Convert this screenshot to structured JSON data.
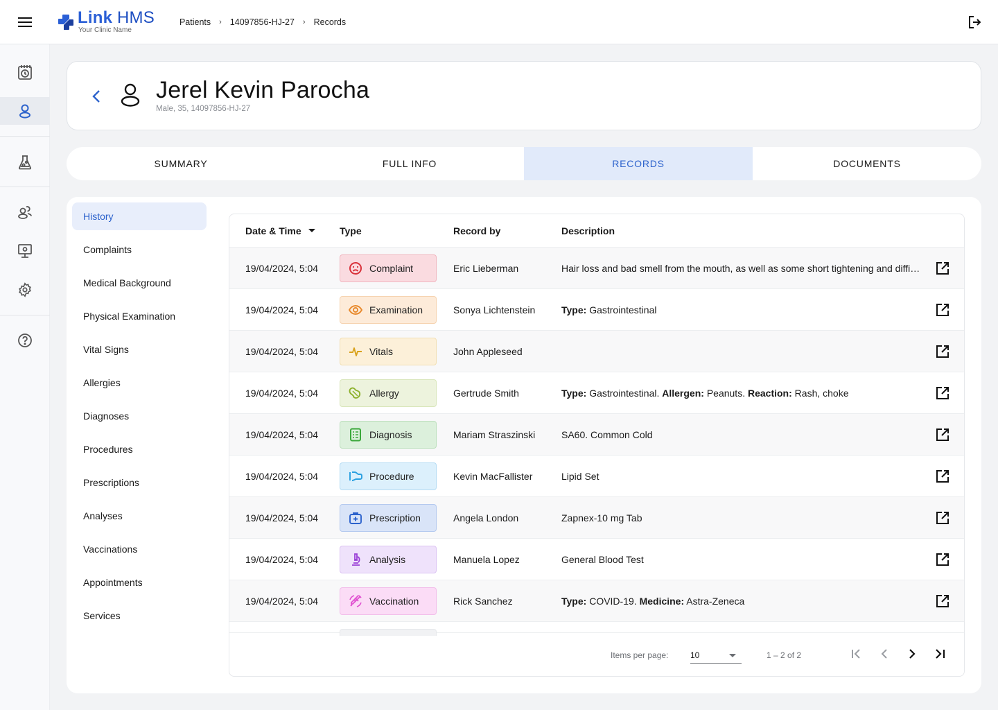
{
  "app": {
    "brand_bold": "Link",
    "brand_rest": "HMS",
    "clinic_name": "Your Clinic Name"
  },
  "icons": {
    "menu": "menu-icon",
    "logout": "logout-icon",
    "back": "chevron-left-icon",
    "avatar": "person-icon",
    "external": "open-in-new-icon"
  },
  "breadcrumb": [
    {
      "label": "Patients"
    },
    {
      "label": "14097856-HJ-27"
    },
    {
      "label": "Records"
    }
  ],
  "rail": [
    {
      "icon": "calendar-clock-icon",
      "active": false
    },
    {
      "icon": "patient-icon",
      "active": true
    },
    {
      "icon": "lab-flask-icon",
      "active": false
    },
    {
      "icon": "users-icon",
      "active": false
    },
    {
      "icon": "monitor-settings-icon",
      "active": false
    },
    {
      "icon": "gear-icon",
      "active": false
    },
    {
      "icon": "help-icon",
      "active": false
    }
  ],
  "patient": {
    "name": "Jerel Kevin Parocha",
    "meta": "Male, 35, 14097856-HJ-27"
  },
  "tabs": [
    {
      "label": "SUMMARY",
      "active": false
    },
    {
      "label": "FULL INFO",
      "active": false
    },
    {
      "label": "RECORDS",
      "active": true
    },
    {
      "label": "DOCUMENTS",
      "active": false
    }
  ],
  "subnav": [
    {
      "label": "History",
      "active": true
    },
    {
      "label": "Complaints"
    },
    {
      "label": "Medical Background"
    },
    {
      "label": "Physical Examination"
    },
    {
      "label": "Vital Signs"
    },
    {
      "label": "Allergies"
    },
    {
      "label": "Diagnoses"
    },
    {
      "label": "Procedures"
    },
    {
      "label": "Prescriptions"
    },
    {
      "label": "Analyses"
    },
    {
      "label": "Vaccinations"
    },
    {
      "label": "Appointments"
    },
    {
      "label": "Services"
    }
  ],
  "table": {
    "columns": {
      "date": "Date & Time",
      "type": "Type",
      "by": "Record by",
      "desc": "Description"
    },
    "rows": [
      {
        "date": "19/04/2024, 5:04",
        "type": "Complaint",
        "icon": "sad-face-icon",
        "color": "#d9313a",
        "bg": "#fadbe0",
        "border": "#f1b7c0",
        "by": "Eric Lieberman",
        "desc": [
          {
            "t": "Hair loss and bad smell from the mouth, as well as some short tightening and difficulty breathing"
          }
        ]
      },
      {
        "date": "19/04/2024, 5:04",
        "type": "Examination",
        "icon": "eye-icon",
        "color": "#e8892b",
        "bg": "#fdebd9",
        "border": "#f6d3b0",
        "by": "Sonya Lichtenstein",
        "desc": [
          {
            "t": "Type:",
            "b": true
          },
          {
            "t": " Gastrointestinal"
          }
        ]
      },
      {
        "date": "19/04/2024, 5:04",
        "type": "Vitals",
        "icon": "pulse-icon",
        "color": "#d9a21c",
        "bg": "#fcf0d9",
        "border": "#f2dfb3",
        "by": "John Appleseed",
        "desc": []
      },
      {
        "date": "19/04/2024, 5:04",
        "type": "Allergy",
        "icon": "peanut-icon",
        "color": "#8cb02a",
        "bg": "#edf3dd",
        "border": "#d9e6bb",
        "by": "Gertrude Smith",
        "desc": [
          {
            "t": "Type:",
            "b": true
          },
          {
            "t": " Gastrointestinal. "
          },
          {
            "t": "Allergen:",
            "b": true
          },
          {
            "t": " Peanuts. "
          },
          {
            "t": "Reaction:",
            "b": true
          },
          {
            "t": " Rash, choke"
          }
        ]
      },
      {
        "date": "19/04/2024, 5:04",
        "type": "Diagnosis",
        "icon": "clipboard-list-icon",
        "color": "#3ba83b",
        "bg": "#dcf0dc",
        "border": "#bde0bd",
        "by": "Mariam Straszinski",
        "desc": [
          {
            "t": "SA60. Common Cold"
          }
        ]
      },
      {
        "date": "19/04/2024, 5:04",
        "type": "Procedure",
        "icon": "bandage-icon",
        "color": "#2aa0e0",
        "bg": "#dcf0fc",
        "border": "#b5dcf3",
        "by": "Kevin MacFallister",
        "desc": [
          {
            "t": "Lipid Set"
          }
        ]
      },
      {
        "date": "19/04/2024, 5:04",
        "type": "Prescription",
        "icon": "medical-kit-icon",
        "color": "#2c62cc",
        "bg": "#d9e4f8",
        "border": "#b4c9ef",
        "by": "Angela London",
        "desc": [
          {
            "t": "Zapnex-10 mg Tab"
          }
        ]
      },
      {
        "date": "19/04/2024, 5:04",
        "type": "Analysis",
        "icon": "microscope-icon",
        "color": "#9a3fd6",
        "bg": "#efe2fb",
        "border": "#dcc4f3",
        "by": "Manuela Lopez",
        "desc": [
          {
            "t": "General Blood Test"
          }
        ]
      },
      {
        "date": "19/04/2024, 5:04",
        "type": "Vaccination",
        "icon": "syringe-icon",
        "color": "#e04fd0",
        "bg": "#fbdcf6",
        "border": "#f2bdea",
        "by": "Rick Sanchez",
        "desc": [
          {
            "t": "Type:",
            "b": true
          },
          {
            "t": " COVID-19. "
          },
          {
            "t": "Medicine:",
            "b": true
          },
          {
            "t": " Astra-Zeneca"
          }
        ]
      }
    ]
  },
  "pager": {
    "label": "Items per page:",
    "per_page": "10",
    "range": "1 – 2 of 2",
    "first": "first-page-icon",
    "prev": "chevron-left-icon",
    "next": "chevron-right-icon",
    "last": "last-page-icon"
  }
}
